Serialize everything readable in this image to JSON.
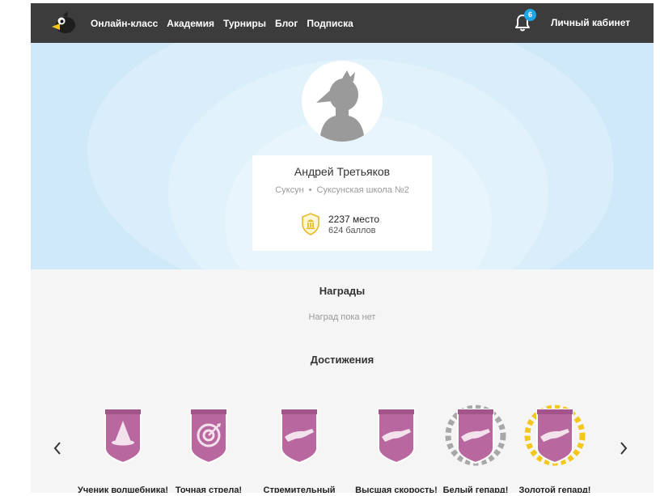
{
  "nav": {
    "links": [
      "Онлайн-класс",
      "Академия",
      "Турниры",
      "Блог",
      "Подписка"
    ],
    "notifications_count": "6",
    "account_label": "Личный кабинет",
    "bg_color": "#3c3c3c",
    "badge_color": "#1ea7e8"
  },
  "profile": {
    "name": "Андрей Третьяков",
    "city": "Суксун",
    "separator": "•",
    "school": "Суксунская школа №2",
    "place": "2237 место",
    "points": "624 баллов"
  },
  "awards": {
    "title": "Награды",
    "empty_text": "Наград пока нет"
  },
  "achievements": {
    "title": "Достижения",
    "items": [
      {
        "label": "Ученик волшебника!",
        "icon": "wizard-hat-icon",
        "wreath": "none"
      },
      {
        "label": "Точная стрела!",
        "icon": "target-icon",
        "wreath": "none"
      },
      {
        "label": "Стремительный",
        "icon": "cheetah-icon",
        "wreath": "none"
      },
      {
        "label": "Высшая скорость!",
        "icon": "cheetah-icon",
        "wreath": "none"
      },
      {
        "label": "Белый гепард!",
        "icon": "cheetah-icon",
        "wreath": "silver"
      },
      {
        "label": "Золотой гепард!",
        "icon": "cheetah-icon",
        "wreath": "gold"
      }
    ],
    "badge_color": "#b9689f",
    "silver_color": "#a8a8a8",
    "gold_color": "#f2c81e"
  }
}
